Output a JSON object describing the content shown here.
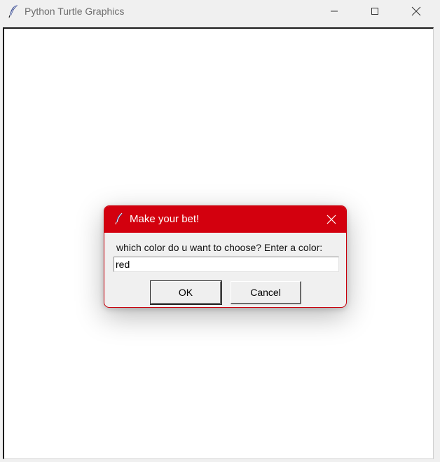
{
  "window": {
    "title": "Python Turtle Graphics",
    "icon": "feather-icon",
    "controls": [
      "minimize-icon",
      "maximize-icon",
      "close-icon"
    ]
  },
  "dialog": {
    "title": "Make your bet!",
    "icon": "feather-icon",
    "prompt": "which color do u want to choose? Enter a color:",
    "input_value": "red",
    "ok_label": "OK",
    "cancel_label": "Cancel",
    "titlebar_color": "#d3000e"
  }
}
